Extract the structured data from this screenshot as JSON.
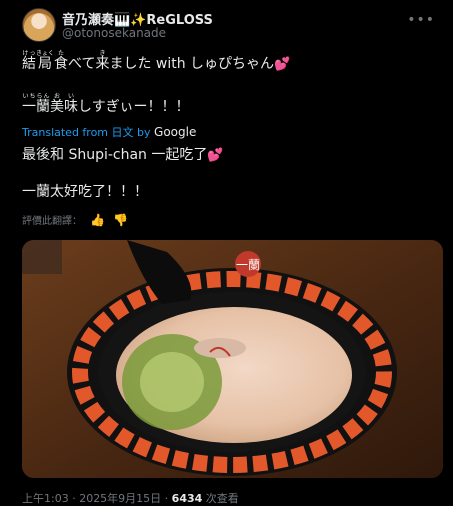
{
  "user": {
    "name": "音乃瀬奏🎹✨ReGLOSS",
    "handle": "@otonosekanade"
  },
  "post": {
    "line1_words": [
      {
        "base": "結",
        "ruby": "けっ"
      },
      {
        "base": "局",
        "ruby": "きょく"
      },
      {
        "base": "食",
        "ruby": "た"
      }
    ],
    "line1_rest": "べて",
    "line1_kuru": {
      "base": "来",
      "ruby": "き"
    },
    "line1_tail": "ました with しゅぴちゃん",
    "line2_words": [
      {
        "base": "一",
        "ruby": "いち"
      },
      {
        "base": "蘭",
        "ruby": "らん"
      },
      {
        "base": "美",
        "ruby": "お"
      },
      {
        "base": "味",
        "ruby": "い"
      }
    ],
    "line2_tail": "しすぎぃー！！！",
    "heart": "💕"
  },
  "translation": {
    "label": "Translated from 日文 by",
    "provider": "Google",
    "line1": "最後和 Shupi-chan 一起吃了",
    "line2": "一蘭太好吃了！！！"
  },
  "rate": {
    "label": "評價此翻譯：",
    "thumbs_up": "👍",
    "thumbs_down": "👎"
  },
  "photo": {
    "bowl_logo": "一蘭"
  },
  "footer": {
    "time": "上午1:03 · 2025年9月15日 · ",
    "views": "6434",
    "views_label": " 次查看"
  }
}
